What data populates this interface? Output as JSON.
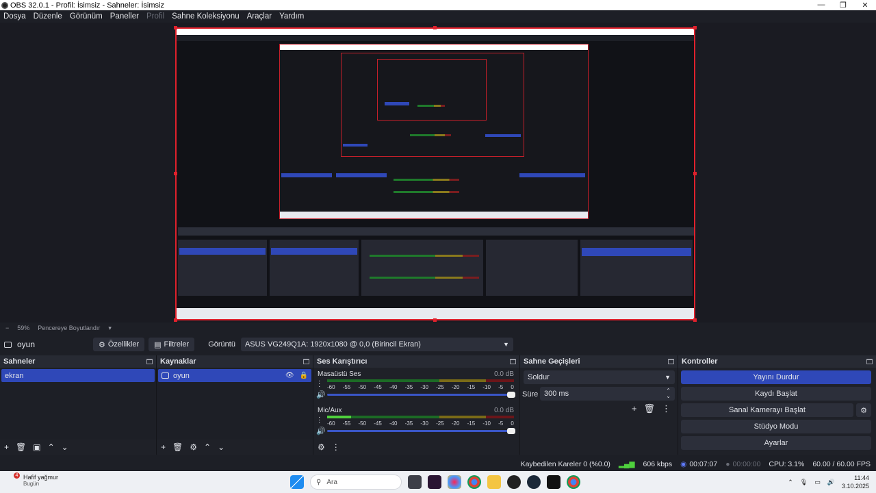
{
  "window": {
    "title": "OBS 32.0.1 - Profil: İsimsiz - Sahneler: İsimsiz"
  },
  "menu": [
    "Dosya",
    "Düzenle",
    "Görünüm",
    "Paneller",
    "Profil",
    "Sahne Koleksiyonu",
    "Araçlar",
    "Yardım"
  ],
  "zoom": {
    "minus": "−",
    "value": "59%",
    "fit_label": "Pencereye Boyutlandır"
  },
  "source_toolbar": {
    "selected_source": "oyun",
    "properties_label": "Özellikler",
    "filters_label": "Filtreler",
    "display_label": "Görüntü",
    "display_value": "ASUS VG249Q1A: 1920x1080 @ 0,0 (Birincil Ekran)"
  },
  "scenes": {
    "title": "Sahneler",
    "items": [
      "ekran"
    ]
  },
  "sources": {
    "title": "Kaynaklar",
    "items": [
      "oyun"
    ]
  },
  "mixer": {
    "title": "Ses Karıştırıcı",
    "ticks": [
      "-60",
      "-55",
      "-50",
      "-45",
      "-40",
      "-35",
      "-30",
      "-25",
      "-20",
      "-15",
      "-10",
      "-5",
      "0"
    ],
    "channels": [
      {
        "name": "Masaüstü Ses",
        "db": "0.0 dB",
        "level": 0.0,
        "volume": 1.0
      },
      {
        "name": "Mic/Aux",
        "db": "0.0 dB",
        "level": 0.13,
        "volume": 1.0
      }
    ]
  },
  "transitions": {
    "title": "Sahne Geçişleri",
    "transition": "Soldur",
    "duration_label": "Süre",
    "duration": "300 ms"
  },
  "controls": {
    "title": "Kontroller",
    "stop_stream": "Yayını Durdur",
    "start_recording": "Kaydı Başlat",
    "virtual_camera": "Sanal Kamerayı Başlat",
    "studio_mode": "Stüdyo Modu",
    "settings": "Ayarlar"
  },
  "status": {
    "dropped_frames": "Kaybedilen Kareler 0 (%0.0)",
    "bitrate": "606 kbps",
    "stream_time": "00:07:07",
    "record_time": "00:00:00",
    "cpu": "CPU: 3.1%",
    "fps": "60.00 / 60.00 FPS"
  },
  "taskbar": {
    "weather_badge": "4",
    "weather_title": "Hafif yağmur",
    "weather_sub": "Bugün",
    "search_placeholder": "Ara",
    "time": "11:44",
    "date": "3.10.2025"
  },
  "colors": {
    "accent": "#2f48b8",
    "selection_border": "#e0212c",
    "panel_bg": "#1d1f26"
  }
}
